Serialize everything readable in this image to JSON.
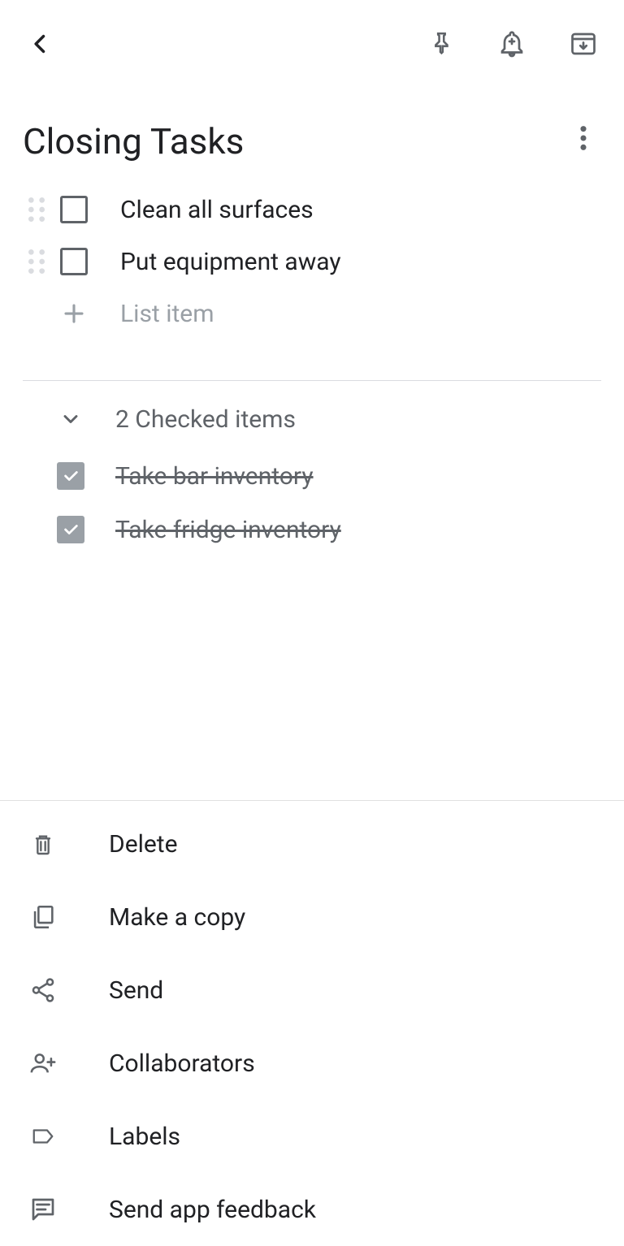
{
  "title": "Closing Tasks",
  "unchecked_items": [
    {
      "text": "Clean all surfaces"
    },
    {
      "text": "Put equipment away"
    }
  ],
  "add_placeholder": "List item",
  "checked_header": "2 Checked items",
  "checked_items": [
    {
      "text": "Take bar inventory"
    },
    {
      "text": "Take fridge inventory"
    }
  ],
  "menu": [
    {
      "id": "delete",
      "label": "Delete"
    },
    {
      "id": "copy",
      "label": "Make a copy"
    },
    {
      "id": "send",
      "label": "Send"
    },
    {
      "id": "collaborators",
      "label": "Collaborators"
    },
    {
      "id": "labels",
      "label": "Labels"
    },
    {
      "id": "feedback",
      "label": "Send app feedback"
    }
  ]
}
